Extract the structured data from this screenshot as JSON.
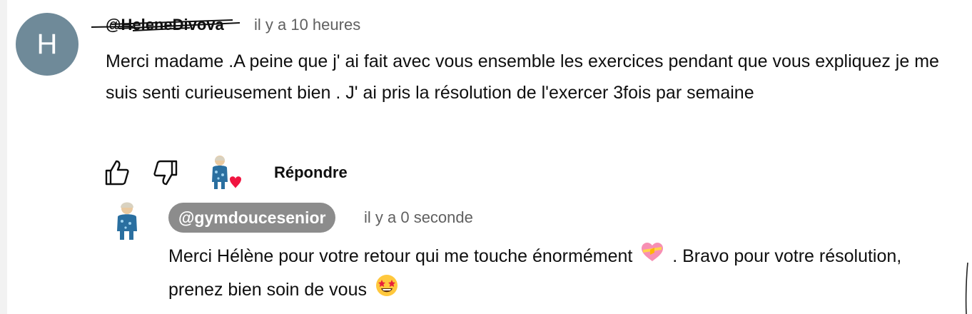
{
  "comment": {
    "avatar_letter": "H",
    "author": "@HeleneDivova",
    "time": "il y a 10 heures",
    "text": "Merci madame .A peine  que j' ai fait avec vous ensemble les exercices pendant que vous expliquez je me suis senti curieusement bien . J' ai pris la résolution de l'exercer 3fois par semaine"
  },
  "actions": {
    "like_icon": "thumb-up-icon",
    "dislike_icon": "thumb-down-icon",
    "creator_heart_icon": "creator-heart-icon",
    "reply_label": "Répondre"
  },
  "reply": {
    "author": "@gymdoucesenior",
    "time": "il y a 0 seconde",
    "text_part1": "Merci Hélène pour votre retour qui me touche énormément",
    "text_part2": ". Bravo pour votre résolution, prenez bien soin de vous",
    "emoji1": "sparkling-heart-emoji",
    "emoji2": "star-struck-emoji"
  },
  "colors": {
    "avatar_bg": "#6f8a99",
    "badge_bg": "#8c8c8c",
    "secondary_text": "#606060",
    "heart_red": "#f01440"
  }
}
